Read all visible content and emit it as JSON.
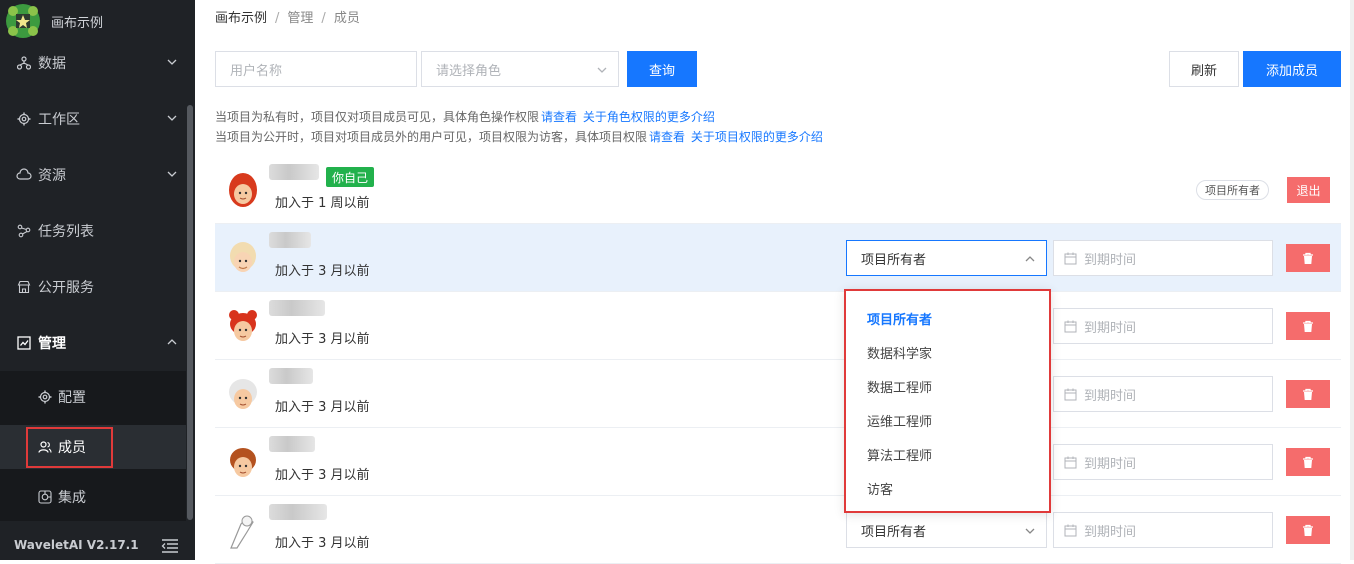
{
  "app": {
    "title": "画布示例",
    "version": "WaveletAI V2.17.1"
  },
  "sidebar": {
    "items": [
      {
        "label": "数据",
        "icon": "data-icon",
        "expandable": true
      },
      {
        "label": "工作区",
        "icon": "workspace-gear-icon",
        "expandable": true
      },
      {
        "label": "资源",
        "icon": "cloud-icon",
        "expandable": true
      },
      {
        "label": "任务列表",
        "icon": "task-flow-icon",
        "expandable": false
      },
      {
        "label": "公开服务",
        "icon": "store-icon",
        "expandable": false
      },
      {
        "label": "管理",
        "icon": "chart-icon",
        "expandable": true,
        "expanded": true
      }
    ],
    "sub_items": [
      {
        "label": "配置",
        "icon": "gear-icon"
      },
      {
        "label": "成员",
        "icon": "users-icon",
        "selected": true
      },
      {
        "label": "集成",
        "icon": "integration-icon"
      }
    ]
  },
  "breadcrumb": [
    "画布示例",
    "管理",
    "成员"
  ],
  "toolbar": {
    "username_placeholder": "用户名称",
    "role_placeholder": "请选择角色",
    "query_label": "查询",
    "refresh_label": "刷新",
    "add_member_label": "添加成员"
  },
  "notices": [
    {
      "text": "当项目为私有时，项目仅对项目成员可见，具体角色操作权限",
      "link1": "请查看",
      "link2": "关于角色权限的更多介绍"
    },
    {
      "text": "当项目为公开时，项目对项目成员外的用户可见，项目权限为访客，具体项目权限",
      "link1": "请查看",
      "link2": "关于项目权限的更多介绍"
    }
  ],
  "members": [
    {
      "joined": "加入于 1 周以前",
      "is_self": true,
      "self_tag": "你自己",
      "role": "项目所有者",
      "action": "退出"
    },
    {
      "joined": "加入于 3 月以前",
      "role": "项目所有者",
      "date_placeholder": "到期时间",
      "dropdown_open": true
    },
    {
      "joined": "加入于 3 月以前",
      "role": "",
      "date_placeholder": "到期时间"
    },
    {
      "joined": "加入于 3 月以前",
      "role": "",
      "date_placeholder": "到期时间"
    },
    {
      "joined": "加入于 3 月以前",
      "role": "",
      "date_placeholder": "到期时间"
    },
    {
      "joined": "加入于 3 月以前",
      "role": "项目所有者",
      "date_placeholder": "到期时间"
    }
  ],
  "role_options": [
    "项目所有者",
    "数据科学家",
    "数据工程师",
    "运维工程师",
    "算法工程师",
    "访客"
  ],
  "selected_role": "项目所有者",
  "colors": {
    "primary": "#1677ff",
    "danger": "#f56c6c",
    "sidebar_bg": "#1f2226",
    "self_tag": "#22b14c",
    "highlight": "#e03a3a"
  }
}
